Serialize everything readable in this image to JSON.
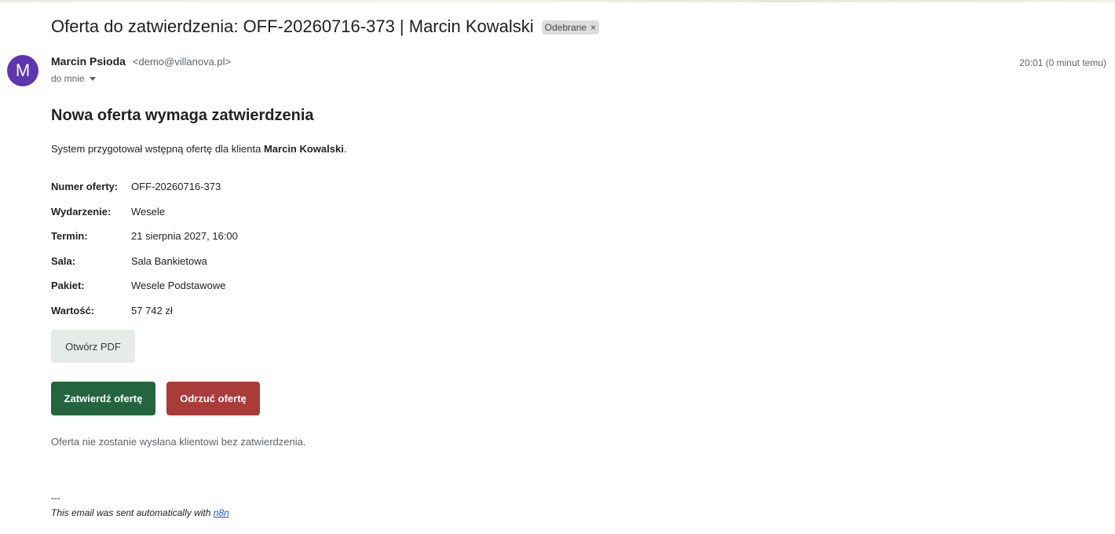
{
  "email": {
    "subject": "Oferta do zatwierdzenia: OFF-20260716-373 | Marcin Kowalski",
    "label": "Odebrane",
    "label_close": "×",
    "avatar_letter": "M",
    "avatar_color": "#5e35b1",
    "sender_name": "Marcin Psioda",
    "sender_email": "<demo@villanova.pl>",
    "recipient": "do mnie",
    "time": "20:01 (0 minut temu)"
  },
  "body": {
    "heading": "Nowa oferta wymaga zatwierdzenia",
    "intro_prefix": "System przygotował wstępną ofertę dla klienta ",
    "intro_client": "Marcin Kowalski",
    "intro_suffix": ".",
    "details": [
      {
        "label": "Numer oferty:",
        "value": "OFF-20260716-373"
      },
      {
        "label": "Wydarzenie:",
        "value": "Wesele"
      },
      {
        "label": "Termin:",
        "value": "21 sierpnia 2027, 16:00"
      },
      {
        "label": "Sala:",
        "value": "Sala Bankietowa"
      },
      {
        "label": "Pakiet:",
        "value": "Wesele Podstawowe"
      },
      {
        "label": "Wartość:",
        "value": "57 742 zł"
      }
    ],
    "pdf_button": "Otwórz PDF",
    "approve_button": "Zatwierdź ofertę",
    "reject_button": "Odrzuć ofertę",
    "approve_color": "#24643e",
    "reject_color": "#a93c39",
    "note": "Oferta nie zostanie wysłana klientowi bez zatwierdzenia."
  },
  "footer": {
    "separator": "---",
    "text": "This email was sent automatically with ",
    "link": "n8n"
  }
}
